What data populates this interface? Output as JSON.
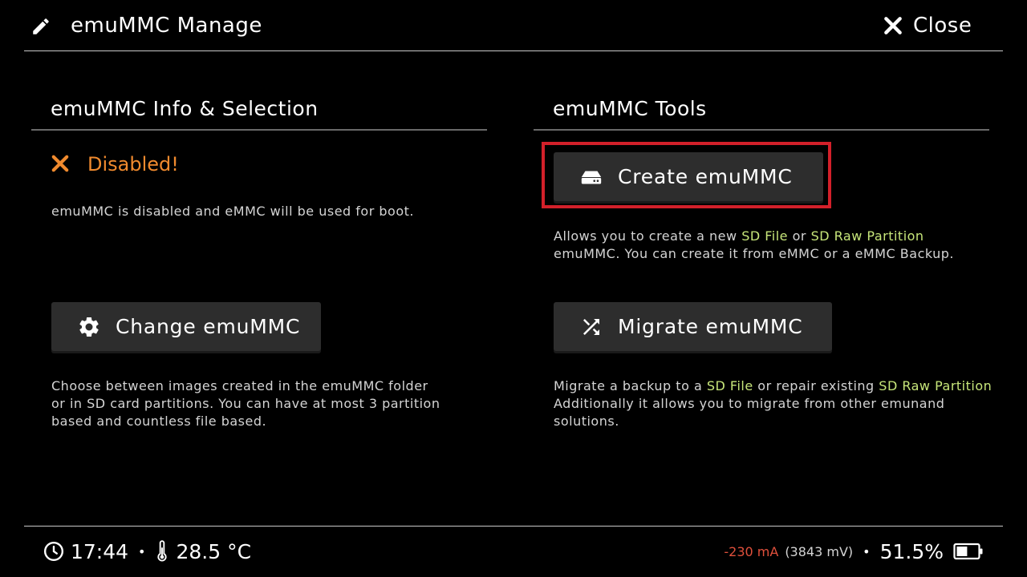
{
  "header": {
    "title": "emuMMC Manage",
    "close_label": "Close"
  },
  "left_section": {
    "title": "emuMMC Info & Selection",
    "status": {
      "label": "Disabled!",
      "color": "#f08a2e",
      "icon": "x-icon"
    },
    "status_description": "emuMMC is disabled and eMMC will be used for boot.",
    "change_button": {
      "label": "Change emuMMC",
      "icon": "gear-icon"
    },
    "change_description": {
      "line1": "Choose between images created in the emuMMC folder",
      "line2": "or in SD card partitions. You can have at most 3 partition",
      "line3": "based and countless file based."
    }
  },
  "right_section": {
    "title": "emuMMC Tools",
    "create_button": {
      "label": "Create emuMMC",
      "icon": "drive-icon"
    },
    "create_description": {
      "line1_a": "Allows you to create a new ",
      "line1_hl1": "SD File",
      "line1_b": " or ",
      "line1_hl2": "SD Raw Partition",
      "line2": "emuMMC. You can create it from eMMC or a eMMC Backup."
    },
    "migrate_button": {
      "label": "Migrate emuMMC",
      "icon": "shuffle-icon"
    },
    "migrate_description": {
      "line1_a": "Migrate a backup to a ",
      "line1_hl1": "SD File",
      "line1_b": " or repair existing ",
      "line1_hl2": "SD Raw Partition",
      "line2": "Additionally it allows you to migrate from other emunand",
      "line3": "solutions."
    },
    "highlight_color": "#d3202a"
  },
  "footer": {
    "time": "17:44",
    "temperature": "28.5 °C",
    "separator": "•",
    "current": "-230 mA",
    "voltage": "(3843 mV)",
    "battery_percent": "51.5%",
    "battery_level": 0.515
  },
  "colors": {
    "accent_highlight": "#c7e67a",
    "warning": "#f08a2e",
    "current_negative": "#e0503c"
  }
}
